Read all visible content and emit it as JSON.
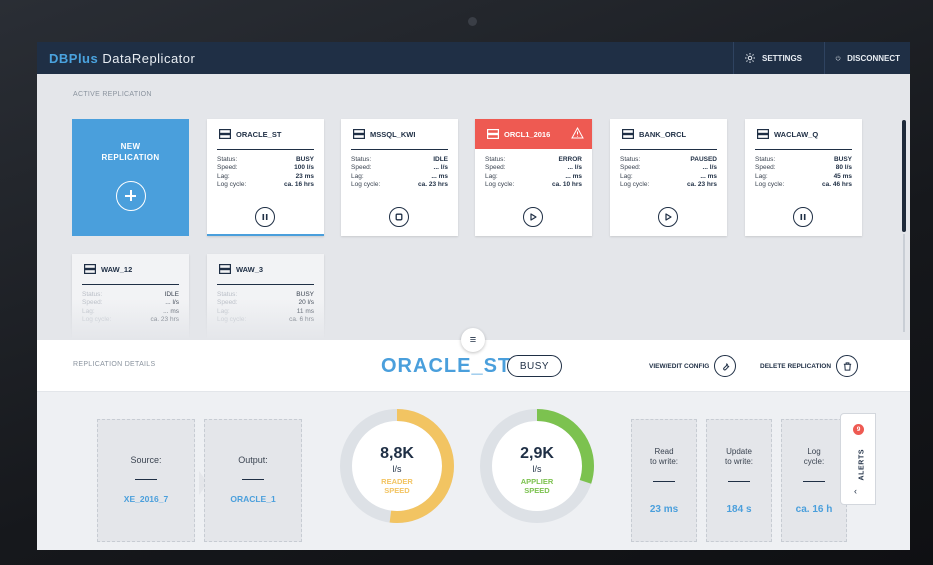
{
  "app": {
    "brand_prefix": "DBPlus",
    "brand_name": "DataReplicator",
    "settings_label": "SETTINGS",
    "disconnect_label": "DISCONNECT",
    "accent": "#4a9fdc",
    "navy": "#1f2f45",
    "error_color": "#ee5a52"
  },
  "active": {
    "section_label": "ACTIVE REPLICATION",
    "new_label_1": "NEW",
    "new_label_2": "REPLICATION",
    "cards": [
      {
        "name": "ORACLE_ST",
        "status": "BUSY",
        "speed": "100 l/s",
        "lag": "23 ms",
        "log_cycle": "ca. 16 hrs",
        "action": "pause-icon",
        "state": "selected"
      },
      {
        "name": "MSSQL_KWI",
        "status": "IDLE",
        "speed": "... l/s",
        "lag": "... ms",
        "log_cycle": "ca. 23 hrs",
        "action": "stop-icon",
        "state": "normal"
      },
      {
        "name": "ORCL1_2016",
        "status": "ERROR",
        "speed": "... l/s",
        "lag": "... ms",
        "log_cycle": "ca. 10 hrs",
        "action": "play-icon",
        "state": "error"
      },
      {
        "name": "BANK_ORCL",
        "status": "PAUSED",
        "speed": "... l/s",
        "lag": "... ms",
        "log_cycle": "ca. 23 hrs",
        "action": "play-icon",
        "state": "normal"
      },
      {
        "name": "WACLAW_Q",
        "status": "BUSY",
        "speed": "80 l/s",
        "lag": "45 ms",
        "log_cycle": "ca. 46 hrs",
        "action": "pause-icon",
        "state": "normal"
      },
      {
        "name": "WAW_12",
        "status": "IDLE",
        "speed": "... l/s",
        "lag": "... ms",
        "log_cycle": "ca. 23 hrs",
        "action": "",
        "state": "dim"
      },
      {
        "name": "WAW_3",
        "status": "BUSY",
        "speed": "20 l/s",
        "lag": "11 ms",
        "log_cycle": "ca. 6 hrs",
        "action": "",
        "state": "dim"
      }
    ],
    "labels": {
      "status": "Status:",
      "speed": "Speed:",
      "lag": "Lag:",
      "log_cycle": "Log cycle:"
    }
  },
  "details": {
    "section_label": "REPLICATION DETAILS",
    "title": "ORACLE_ST",
    "badge": "BUSY",
    "view_edit_label": "VIEW/EDIT CONFIG",
    "delete_label": "DELETE REPLICATION",
    "source_label": "Source:",
    "source_value": "XE_2016_7",
    "output_label": "Output:",
    "output_value": "ORACLE_1",
    "reader": {
      "value": "8,8K",
      "unit": "l/s",
      "name_1": "READER",
      "name_2": "SPEED",
      "fill": 0.52,
      "color": "#f2c462"
    },
    "applier": {
      "value": "2,9K",
      "unit": "l/s",
      "name_1": "APPLIER",
      "name_2": "SPEED",
      "fill": 0.3,
      "color": "#7cc24f"
    },
    "stats": [
      {
        "label_1": "Read",
        "label_2": "to write:",
        "value": "23 ms"
      },
      {
        "label_1": "Update",
        "label_2": "to write:",
        "value": "184 s"
      },
      {
        "label_1": "Log",
        "label_2": "cycle:",
        "value": "ca. 16 h"
      }
    ]
  },
  "alerts": {
    "label": "ALERTS",
    "count": "9"
  }
}
